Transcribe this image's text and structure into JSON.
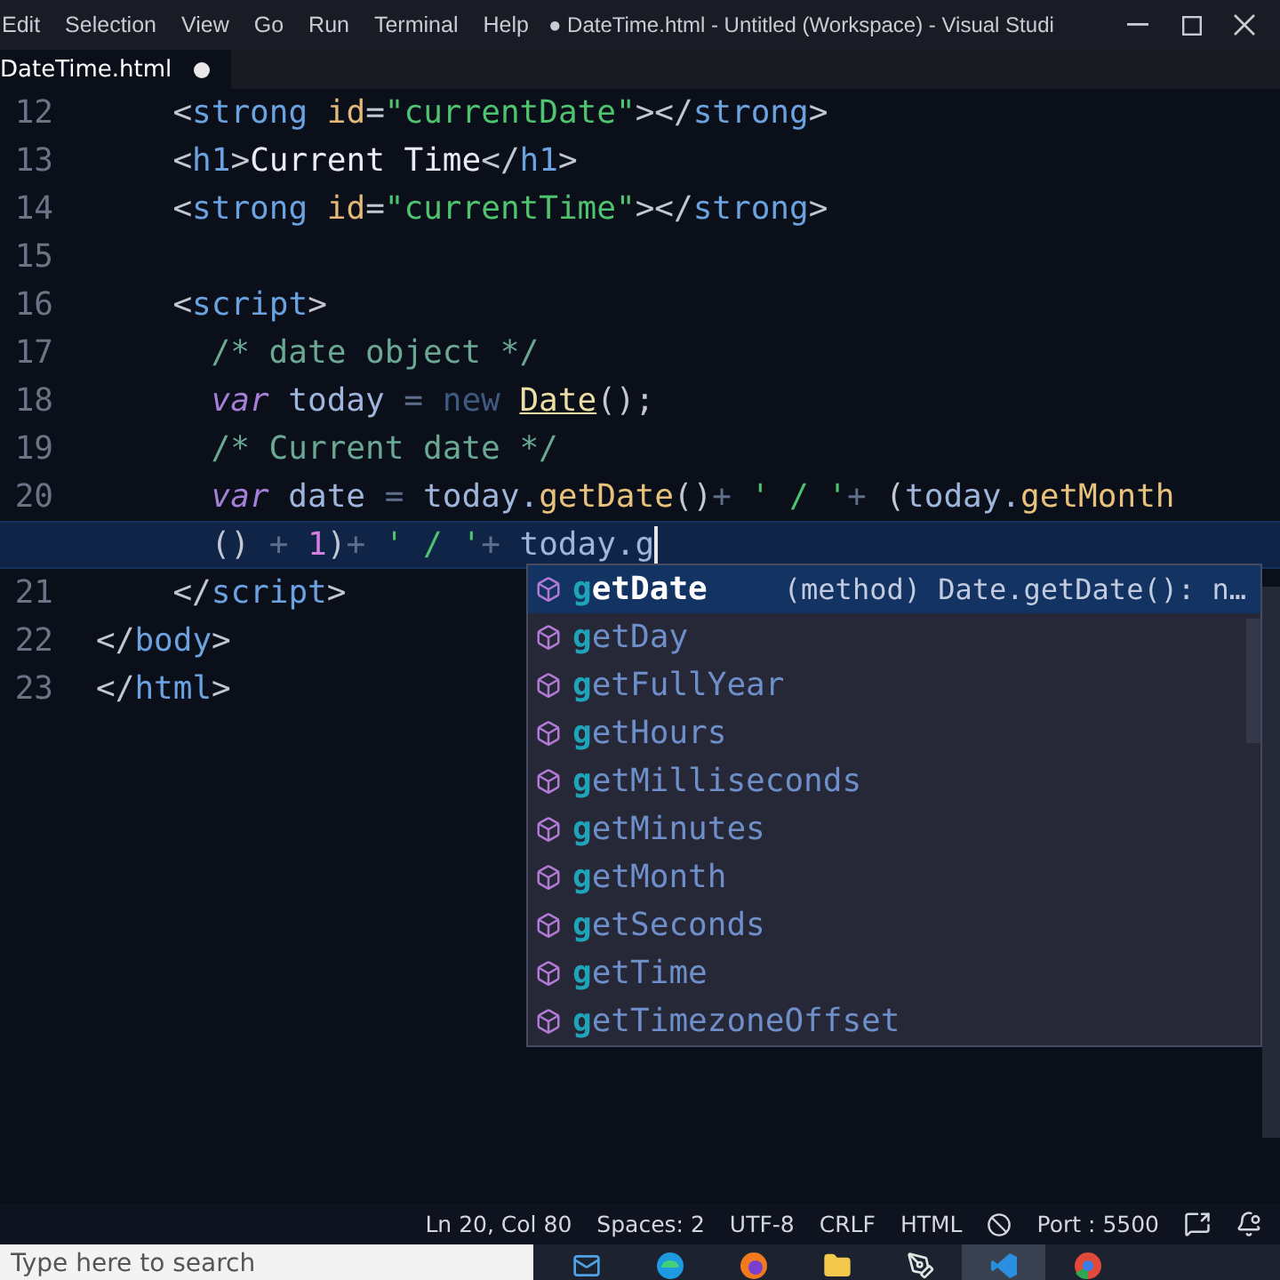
{
  "menu": [
    {
      "label": "Edit"
    },
    {
      "label": "Selection"
    },
    {
      "label": "View"
    },
    {
      "label": "Go"
    },
    {
      "label": "Run"
    },
    {
      "label": "Terminal"
    },
    {
      "label": "Help"
    }
  ],
  "window": {
    "title": "● DateTime.html - Untitled (Workspace) - Visual Studi"
  },
  "tabs": [
    {
      "label": "DateTime.html",
      "selected": true,
      "modified": true
    }
  ],
  "editor": {
    "lines": [
      {
        "number": "12",
        "rows": [
          {
            "kind": "nested",
            "current": false,
            "tokens": [
              {
                "kind": "punct",
                "text": "<"
              },
              {
                "kind": "tag",
                "text": "strong"
              },
              {
                "kind": "attr",
                "text": " id"
              },
              {
                "kind": "punct",
                "text": "="
              },
              {
                "kind": "string",
                "text": "\"currentDate\""
              },
              {
                "kind": "punct",
                "text": "></"
              },
              {
                "kind": "tag",
                "text": "strong"
              },
              {
                "kind": "punct",
                "text": ">"
              }
            ]
          }
        ]
      },
      {
        "number": "13",
        "rows": [
          {
            "kind": "nested",
            "current": false,
            "tokens": [
              {
                "kind": "punct",
                "text": "<"
              },
              {
                "kind": "tag",
                "text": "h1"
              },
              {
                "kind": "punct",
                "text": ">"
              },
              {
                "kind": "text",
                "text": "Current Time"
              },
              {
                "kind": "punct",
                "text": "</"
              },
              {
                "kind": "tag",
                "text": "h1"
              },
              {
                "kind": "punct",
                "text": ">"
              }
            ]
          }
        ]
      },
      {
        "number": "14",
        "rows": [
          {
            "kind": "nested",
            "current": false,
            "tokens": [
              {
                "kind": "punct",
                "text": "<"
              },
              {
                "kind": "tag",
                "text": "strong"
              },
              {
                "kind": "attr",
                "text": " id"
              },
              {
                "kind": "punct",
                "text": "="
              },
              {
                "kind": "string",
                "text": "\"currentTime\""
              },
              {
                "kind": "punct",
                "text": "></"
              },
              {
                "kind": "tag",
                "text": "strong"
              },
              {
                "kind": "punct",
                "text": ">"
              }
            ]
          }
        ]
      },
      {
        "number": "15",
        "rows": [
          {
            "kind": "top",
            "current": false
          }
        ]
      },
      {
        "number": "16",
        "rows": [
          {
            "kind": "nested",
            "current": false,
            "tokens": [
              {
                "kind": "punct",
                "text": "<"
              },
              {
                "kind": "tag",
                "text": "script"
              },
              {
                "kind": "punct",
                "text": ">"
              }
            ]
          }
        ]
      },
      {
        "number": "17",
        "rows": [
          {
            "kind": "inner",
            "current": false,
            "tokens": [
              {
                "kind": "comment",
                "text": "/* date object */"
              }
            ]
          }
        ]
      },
      {
        "number": "18",
        "rows": [
          {
            "kind": "inner",
            "current": false,
            "tokens": [
              {
                "kind": "keyword",
                "text": "var"
              },
              {
                "kind": "ident",
                "text": " today "
              },
              {
                "kind": "op",
                "text": "= "
              },
              {
                "kind": "new",
                "text": "new "
              },
              {
                "kind": "class",
                "text": "Date"
              },
              {
                "kind": "punct",
                "text": "();"
              }
            ]
          }
        ]
      },
      {
        "number": "19",
        "rows": [
          {
            "kind": "inner",
            "current": false,
            "tokens": [
              {
                "kind": "comment",
                "text": "/* Current date */"
              }
            ]
          }
        ]
      },
      {
        "number": "20",
        "rows": [
          {
            "kind": "inner",
            "current": false,
            "tokens": [
              {
                "kind": "keyword",
                "text": "var"
              },
              {
                "kind": "ident",
                "text": " date "
              },
              {
                "kind": "op",
                "text": "= "
              },
              {
                "kind": "ident",
                "text": "today."
              },
              {
                "kind": "fn",
                "text": "getDate"
              },
              {
                "kind": "punct",
                "text": "()"
              },
              {
                "kind": "op",
                "text": "+ "
              },
              {
                "kind": "string",
                "text": "' / '"
              },
              {
                "kind": "op",
                "text": "+ "
              },
              {
                "kind": "punct",
                "text": "("
              },
              {
                "kind": "ident",
                "text": "today."
              },
              {
                "kind": "fn",
                "text": "getMonth"
              }
            ]
          },
          {
            "kind": "inner",
            "current": true,
            "tokens": [
              {
                "kind": "punct",
                "text": "() "
              },
              {
                "kind": "op",
                "text": "+ "
              },
              {
                "kind": "number",
                "text": "1"
              },
              {
                "kind": "punct",
                "text": ")"
              },
              {
                "kind": "op",
                "text": "+ "
              },
              {
                "kind": "string",
                "text": "' / '"
              },
              {
                "kind": "op",
                "text": "+ "
              },
              {
                "kind": "ident",
                "text": "today.g"
              }
            ]
          }
        ]
      },
      {
        "number": "21",
        "rows": [
          {
            "kind": "nested",
            "current": false,
            "tokens": [
              {
                "kind": "punct",
                "text": "</"
              },
              {
                "kind": "tag",
                "text": "script"
              },
              {
                "kind": "punct",
                "text": ">"
              }
            ]
          }
        ]
      },
      {
        "number": "22",
        "rows": [
          {
            "kind": "top",
            "current": false,
            "tokens": [
              {
                "kind": "punct",
                "text": "</"
              },
              {
                "kind": "tag",
                "text": "body"
              },
              {
                "kind": "punct",
                "text": ">"
              }
            ]
          }
        ]
      },
      {
        "number": "23",
        "rows": [
          {
            "kind": "top",
            "current": false,
            "tokens": [
              {
                "kind": "punct",
                "text": "</"
              },
              {
                "kind": "tag",
                "text": "html"
              },
              {
                "kind": "punct",
                "text": ">"
              }
            ]
          }
        ]
      }
    ]
  },
  "suggest": {
    "items": [
      {
        "match": "g",
        "rest": "etDate",
        "selected": true,
        "detail": "(method) Date.getDate(): n…"
      },
      {
        "match": "g",
        "rest": "etDay",
        "selected": false
      },
      {
        "match": "g",
        "rest": "etFullYear",
        "selected": false
      },
      {
        "match": "g",
        "rest": "etHours",
        "selected": false
      },
      {
        "match": "g",
        "rest": "etMilliseconds",
        "selected": false
      },
      {
        "match": "g",
        "rest": "etMinutes",
        "selected": false
      },
      {
        "match": "g",
        "rest": "etMonth",
        "selected": false
      },
      {
        "match": "g",
        "rest": "etSeconds",
        "selected": false
      },
      {
        "match": "g",
        "rest": "etTime",
        "selected": false
      },
      {
        "match": "g",
        "rest": "etTimezoneOffset",
        "selected": false
      }
    ]
  },
  "status_bar": {
    "items": [
      {
        "kind": "text",
        "text": "Ln 20, Col 80"
      },
      {
        "kind": "text",
        "text": "Spaces: 2"
      },
      {
        "kind": "text",
        "text": "UTF-8"
      },
      {
        "kind": "text",
        "text": "CRLF"
      },
      {
        "kind": "text",
        "text": "HTML"
      },
      {
        "kind": "port",
        "text": "Port : 5500"
      },
      {
        "kind": "feedback"
      },
      {
        "kind": "bell"
      }
    ]
  },
  "taskbar": {
    "search": {
      "placeholder": "Type here to search"
    },
    "apps": [
      {
        "kind": "mail",
        "selected": false
      },
      {
        "kind": "edge",
        "selected": false
      },
      {
        "kind": "firefox",
        "selected": false
      },
      {
        "kind": "folder",
        "selected": false
      },
      {
        "kind": "pen",
        "selected": false
      },
      {
        "kind": "code",
        "selected": true
      },
      {
        "kind": "chrome",
        "selected": false
      }
    ]
  }
}
